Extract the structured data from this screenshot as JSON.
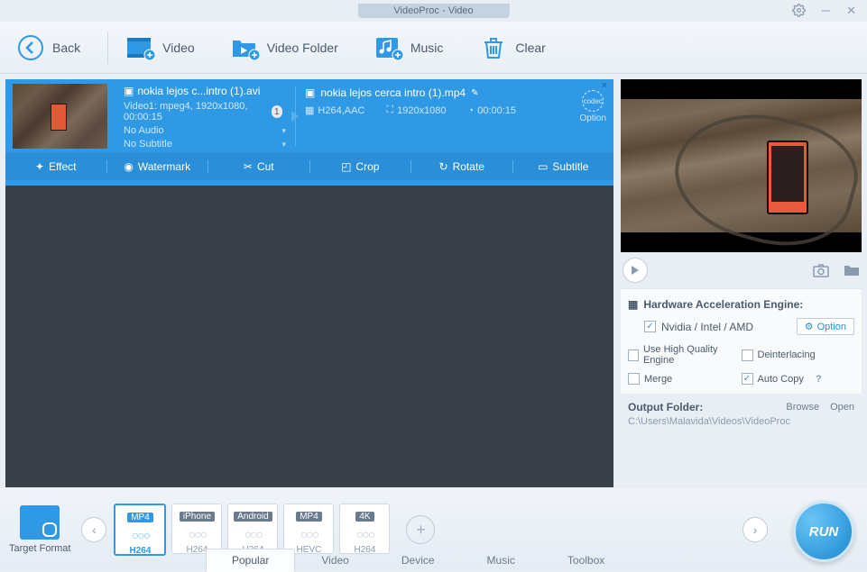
{
  "titlebar": {
    "title": "VideoProc - Video"
  },
  "toolbar": {
    "back": "Back",
    "video": "Video",
    "video_folder": "Video Folder",
    "music": "Music",
    "clear": "Clear"
  },
  "clip": {
    "src_title": "nokia lejos c...intro (1).avi",
    "video_line": "Video1: mpeg4, 1920x1080, 00:00:15",
    "audio_line": "No Audio",
    "subtitle_line": "No Subtitle",
    "badge": "1",
    "out_title": "nokia lejos cerca intro (1).mp4",
    "out_codec": "H264,AAC",
    "out_res": "1920x1080",
    "out_dur": "00:00:15",
    "option_label": "Option",
    "actions": {
      "effect": "Effect",
      "watermark": "Watermark",
      "cut": "Cut",
      "crop": "Crop",
      "rotate": "Rotate",
      "subtitle": "Subtitle"
    }
  },
  "hw": {
    "title": "Hardware Acceleration Engine:",
    "vendors": "Nvidia / Intel / AMD",
    "option_btn": "Option",
    "hq": "Use High Quality Engine",
    "deint": "Deinterlacing",
    "merge": "Merge",
    "autocopy": "Auto Copy",
    "help": "?"
  },
  "output": {
    "label": "Output Folder:",
    "browse": "Browse",
    "open": "Open",
    "path": "C:\\Users\\Malavida\\Videos\\VideoProc"
  },
  "formats": {
    "target_label": "Target Format",
    "list": [
      {
        "top": "MP4",
        "bot": "H264",
        "sel": true
      },
      {
        "top": "iPhone",
        "bot": "H264",
        "sel": false
      },
      {
        "top": "Android",
        "bot": "H264",
        "sel": false
      },
      {
        "top": "MP4",
        "bot": "HEVC",
        "sel": false
      },
      {
        "top": "4K",
        "bot": "H264",
        "sel": false
      }
    ]
  },
  "tabs": {
    "popular": "Popular",
    "video": "Video",
    "device": "Device",
    "music": "Music",
    "toolbox": "Toolbox"
  },
  "run": "RUN"
}
